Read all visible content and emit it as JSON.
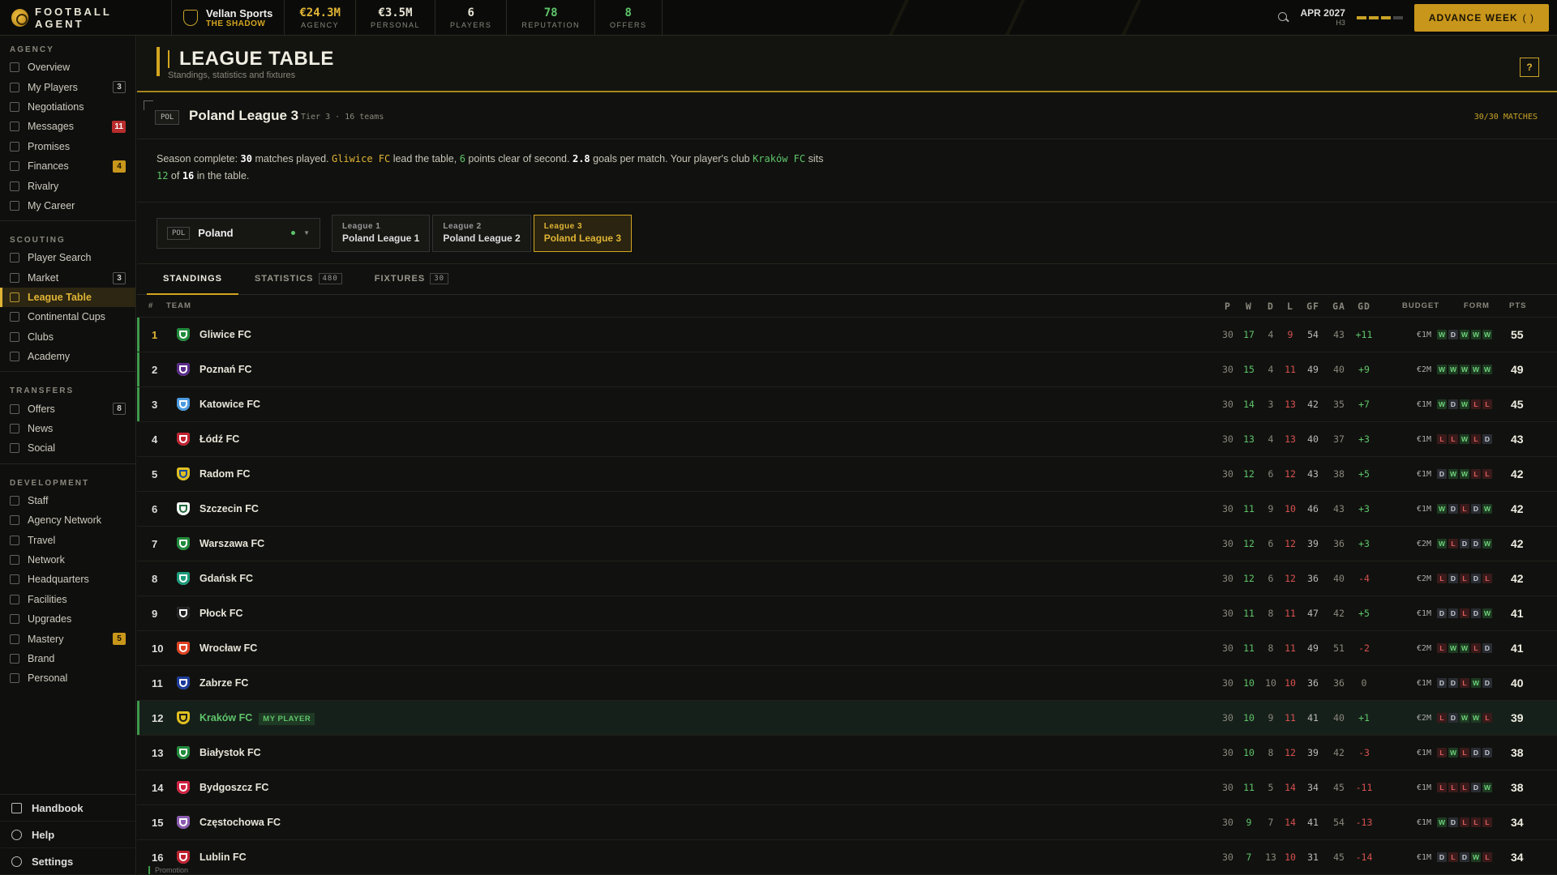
{
  "topbar": {
    "logo": "FOOTBALL AGENT",
    "agency_name": "Vellan Sports",
    "agency_sub": "THE SHADOW",
    "stats": [
      {
        "value": "€24.3M",
        "label": "AGENCY",
        "color": "#e0b435"
      },
      {
        "value": "€3.5M",
        "label": "PERSONAL",
        "color": "#e8e4d4"
      },
      {
        "value": "6",
        "label": "PLAYERS",
        "color": "#e8e4d4"
      },
      {
        "value": "78",
        "label": "REPUTATION",
        "color": "#5ec46a"
      },
      {
        "value": "8",
        "label": "OFFERS",
        "color": "#5ec46a"
      }
    ],
    "date": "APR 2027",
    "date_sub": "H3",
    "advance_label": "ADVANCE WEEK",
    "advance_hint": "( )"
  },
  "sidebar": {
    "sections": [
      {
        "title": "AGENCY",
        "items": [
          {
            "label": "Overview"
          },
          {
            "label": "My Players",
            "badge": "3",
            "badge_type": "gray"
          },
          {
            "label": "Negotiations"
          },
          {
            "label": "Messages",
            "badge": "11",
            "badge_type": "red"
          },
          {
            "label": "Promises"
          },
          {
            "label": "Finances",
            "badge": "4",
            "badge_type": "gold"
          },
          {
            "label": "Rivalry"
          },
          {
            "label": "My Career"
          }
        ]
      },
      {
        "title": "SCOUTING",
        "items": [
          {
            "label": "Player Search"
          },
          {
            "label": "Market",
            "badge": "3",
            "badge_type": "gray"
          },
          {
            "label": "League Table",
            "active": true
          },
          {
            "label": "Continental Cups"
          },
          {
            "label": "Clubs"
          },
          {
            "label": "Academy"
          }
        ]
      },
      {
        "title": "TRANSFERS",
        "items": [
          {
            "label": "Offers",
            "badge": "8",
            "badge_type": "gray"
          },
          {
            "label": "News"
          },
          {
            "label": "Social"
          }
        ]
      },
      {
        "title": "DEVELOPMENT",
        "items": [
          {
            "label": "Staff"
          },
          {
            "label": "Agency Network"
          },
          {
            "label": "Travel"
          },
          {
            "label": "Network"
          },
          {
            "label": "Headquarters"
          },
          {
            "label": "Facilities"
          },
          {
            "label": "Upgrades"
          },
          {
            "label": "Mastery",
            "badge": "5",
            "badge_type": "gold"
          },
          {
            "label": "Brand"
          },
          {
            "label": "Personal"
          }
        ]
      }
    ],
    "bottom": [
      "Handbook",
      "Help",
      "Settings"
    ]
  },
  "header": {
    "title": "LEAGUE TABLE",
    "subtitle": "Standings, statistics and fixtures",
    "help": "?"
  },
  "league": {
    "code": "POL",
    "name": "Poland League 3",
    "tier": "Tier 3 · 16 teams",
    "matches": "30/30 MATCHES"
  },
  "summary": {
    "p1": "Season complete: ",
    "played": "30",
    "p2": " matches played. ",
    "leader": "Gliwice FC",
    "p3": " lead the table, ",
    "gap": "6",
    "p4": " points clear of second. ",
    "gpm": "2.8",
    "p5": " goals per match. Your player's club ",
    "club": "Kraków FC",
    "p6": " sits",
    "pos": "12",
    "p7": " of ",
    "total": "16",
    "p8": " in the table."
  },
  "selector": {
    "country_code": "POL",
    "country": "Poland",
    "leagues": [
      {
        "a": "League 1",
        "b": "Poland League 1"
      },
      {
        "a": "League 2",
        "b": "Poland League 2"
      },
      {
        "a": "League 3",
        "b": "Poland League 3",
        "selected": true
      }
    ]
  },
  "tabs": [
    {
      "label": "STANDINGS",
      "active": true
    },
    {
      "label": "STATISTICS",
      "count": "480"
    },
    {
      "label": "FIXTURES",
      "count": "30"
    }
  ],
  "columns": {
    "pos": "#",
    "team": "TEAM",
    "p": "P",
    "w": "W",
    "d": "D",
    "l": "L",
    "gf": "GF",
    "ga": "GA",
    "gd": "GD",
    "budget": "BUDGET",
    "form": "FORM",
    "pts": "PTS"
  },
  "my_player_tag": "MY PLAYER",
  "rows": [
    {
      "pos": "1",
      "team": "Gliwice FC",
      "p": "30",
      "w": "17",
      "d": "4",
      "l": "9",
      "gf": "54",
      "ga": "43",
      "gd": "+11",
      "budget": "€1M",
      "form": [
        "W",
        "D",
        "W",
        "W",
        "W"
      ],
      "pts": "55",
      "crest": [
        "#1f8a3a",
        "#ffffff"
      ],
      "promo": true
    },
    {
      "pos": "2",
      "team": "Poznań FC",
      "p": "30",
      "w": "15",
      "d": "4",
      "l": "11",
      "gf": "49",
      "ga": "40",
      "gd": "+9",
      "budget": "€2M",
      "form": [
        "W",
        "W",
        "W",
        "W",
        "W"
      ],
      "pts": "49",
      "crest": [
        "#5a2a8a",
        "#ffffff"
      ],
      "promo": true
    },
    {
      "pos": "3",
      "team": "Katowice FC",
      "p": "30",
      "w": "14",
      "d": "3",
      "l": "13",
      "gf": "42",
      "ga": "35",
      "gd": "+7",
      "budget": "€1M",
      "form": [
        "W",
        "D",
        "W",
        "L",
        "L"
      ],
      "pts": "45",
      "crest": [
        "#4a9ae0",
        "#ffffff"
      ],
      "promo": true
    },
    {
      "pos": "4",
      "team": "Łódź FC",
      "p": "30",
      "w": "13",
      "d": "4",
      "l": "13",
      "gf": "40",
      "ga": "37",
      "gd": "+3",
      "budget": "€1M",
      "form": [
        "L",
        "L",
        "W",
        "L",
        "D"
      ],
      "pts": "43",
      "crest": [
        "#c02030",
        "#ffffff"
      ]
    },
    {
      "pos": "5",
      "team": "Radom FC",
      "p": "30",
      "w": "12",
      "d": "6",
      "l": "12",
      "gf": "43",
      "ga": "38",
      "gd": "+5",
      "budget": "€1M",
      "form": [
        "D",
        "W",
        "W",
        "L",
        "L"
      ],
      "pts": "42",
      "crest": [
        "#e0c020",
        "#1a4a9a"
      ]
    },
    {
      "pos": "6",
      "team": "Szczecin FC",
      "p": "30",
      "w": "11",
      "d": "9",
      "l": "10",
      "gf": "46",
      "ga": "43",
      "gd": "+3",
      "budget": "€1M",
      "form": [
        "W",
        "D",
        "L",
        "D",
        "W"
      ],
      "pts": "42",
      "crest": [
        "#ffffff",
        "#1f6a3a"
      ]
    },
    {
      "pos": "7",
      "team": "Warszawa FC",
      "p": "30",
      "w": "12",
      "d": "6",
      "l": "12",
      "gf": "39",
      "ga": "36",
      "gd": "+3",
      "budget": "€2M",
      "form": [
        "W",
        "L",
        "D",
        "D",
        "W"
      ],
      "pts": "42",
      "crest": [
        "#1f8a3a",
        "#ffffff"
      ]
    },
    {
      "pos": "8",
      "team": "Gdańsk FC",
      "p": "30",
      "w": "12",
      "d": "6",
      "l": "12",
      "gf": "36",
      "ga": "40",
      "gd": "-4",
      "budget": "€2M",
      "form": [
        "L",
        "D",
        "L",
        "D",
        "L"
      ],
      "pts": "42",
      "crest": [
        "#1a9a7a",
        "#ffffff"
      ]
    },
    {
      "pos": "9",
      "team": "Płock FC",
      "p": "30",
      "w": "11",
      "d": "8",
      "l": "11",
      "gf": "47",
      "ga": "42",
      "gd": "+5",
      "budget": "€1M",
      "form": [
        "D",
        "D",
        "L",
        "D",
        "W"
      ],
      "pts": "41",
      "crest": [
        "#222222",
        "#ffffff"
      ]
    },
    {
      "pos": "10",
      "team": "Wrocław FC",
      "p": "30",
      "w": "11",
      "d": "8",
      "l": "11",
      "gf": "49",
      "ga": "51",
      "gd": "-2",
      "budget": "€2M",
      "form": [
        "L",
        "W",
        "W",
        "L",
        "D"
      ],
      "pts": "41",
      "crest": [
        "#e04020",
        "#ffffff"
      ]
    },
    {
      "pos": "11",
      "team": "Zabrze FC",
      "p": "30",
      "w": "10",
      "d": "10",
      "l": "10",
      "gf": "36",
      "ga": "36",
      "gd": "0",
      "budget": "€1M",
      "form": [
        "D",
        "D",
        "L",
        "W",
        "D"
      ],
      "pts": "40",
      "crest": [
        "#1a3a9a",
        "#ffffff"
      ]
    },
    {
      "pos": "12",
      "team": "Kraków FC",
      "p": "30",
      "w": "10",
      "d": "9",
      "l": "11",
      "gf": "41",
      "ga": "40",
      "gd": "+1",
      "budget": "€2M",
      "form": [
        "L",
        "D",
        "W",
        "W",
        "L"
      ],
      "pts": "39",
      "crest": [
        "#e0c020",
        "#1a1a1a"
      ],
      "mine": true
    },
    {
      "pos": "13",
      "team": "Białystok FC",
      "p": "30",
      "w": "10",
      "d": "8",
      "l": "12",
      "gf": "39",
      "ga": "42",
      "gd": "-3",
      "budget": "€1M",
      "form": [
        "L",
        "W",
        "L",
        "D",
        "D"
      ],
      "pts": "38",
      "crest": [
        "#1f8a3a",
        "#ffffff"
      ]
    },
    {
      "pos": "14",
      "team": "Bydgoszcz FC",
      "p": "30",
      "w": "11",
      "d": "5",
      "l": "14",
      "gf": "34",
      "ga": "45",
      "gd": "-11",
      "budget": "€1M",
      "form": [
        "L",
        "L",
        "L",
        "D",
        "W"
      ],
      "pts": "38",
      "crest": [
        "#d02040",
        "#ffffff"
      ]
    },
    {
      "pos": "15",
      "team": "Częstochowa FC",
      "p": "30",
      "w": "9",
      "d": "7",
      "l": "14",
      "gf": "41",
      "ga": "54",
      "gd": "-13",
      "budget": "€1M",
      "form": [
        "W",
        "D",
        "L",
        "L",
        "L"
      ],
      "pts": "34",
      "crest": [
        "#8a5ab0",
        "#ffffff"
      ]
    },
    {
      "pos": "16",
      "team": "Lublin FC",
      "p": "30",
      "w": "7",
      "d": "13",
      "l": "10",
      "gf": "31",
      "ga": "45",
      "gd": "-14",
      "budget": "€1M",
      "form": [
        "D",
        "L",
        "D",
        "W",
        "L"
      ],
      "pts": "34",
      "crest": [
        "#c02030",
        "#ffffff"
      ]
    }
  ],
  "footer": {
    "legend": "Promotion"
  }
}
